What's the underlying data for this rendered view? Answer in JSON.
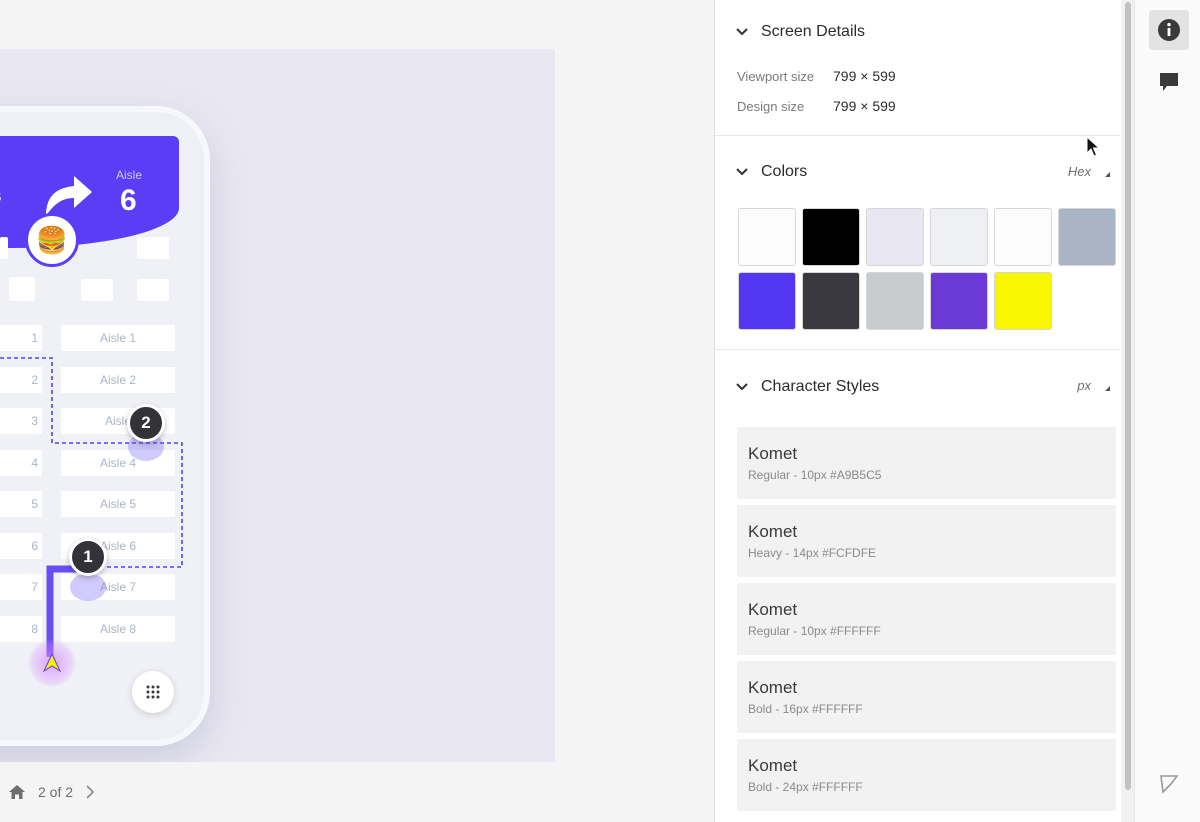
{
  "canvas": {
    "banner": {
      "left_small": "up",
      "left_big": "ers",
      "right_small": "Aisle",
      "right_big": "6"
    },
    "burger_emoji": "🍔",
    "aisles_left": [
      "1",
      "2",
      "3",
      "4",
      "5",
      "6",
      "7",
      "8"
    ],
    "aisles_right": [
      "Aisle 1",
      "Aisle 2",
      "Aisle",
      "Aisle 4",
      "Aisle 5",
      "Aisle 6",
      "Aisle 7",
      "Aisle 8"
    ],
    "pins": [
      "1",
      "2"
    ],
    "brand_color": "#5A3DF5",
    "route_color": "#5A3DF5",
    "location_color": "#F8EE00"
  },
  "pager": {
    "label": "2 of 2"
  },
  "panel": {
    "screen_details": {
      "title": "Screen Details",
      "rows": [
        {
          "label": "Viewport size",
          "value": "799 × 599"
        },
        {
          "label": "Design size",
          "value": "799 × 599"
        }
      ]
    },
    "colors": {
      "title": "Colors",
      "format": "Hex",
      "swatches": [
        "#FCFCFC",
        "#000000",
        "#E9E8F2",
        "#EEF0F3",
        "#FCFCFC",
        "#A9B5C5",
        "#5236F2",
        "#3A3940",
        "#C8CCCF",
        "#6B3AD6",
        "#F8F600"
      ]
    },
    "character_styles": {
      "title": "Character Styles",
      "unit": "px",
      "items": [
        {
          "name": "Komet",
          "meta": "Regular - 10px #A9B5C5"
        },
        {
          "name": "Komet",
          "meta": "Heavy - 14px #FCFDFE"
        },
        {
          "name": "Komet",
          "meta": "Regular - 10px #FFFFFF"
        },
        {
          "name": "Komet",
          "meta": "Bold - 16px #FFFFFF"
        },
        {
          "name": "Komet",
          "meta": "Bold - 24px #FFFFFF"
        }
      ]
    }
  },
  "rail": {
    "icons": [
      "info-icon",
      "comment-icon",
      "flag-icon"
    ]
  }
}
